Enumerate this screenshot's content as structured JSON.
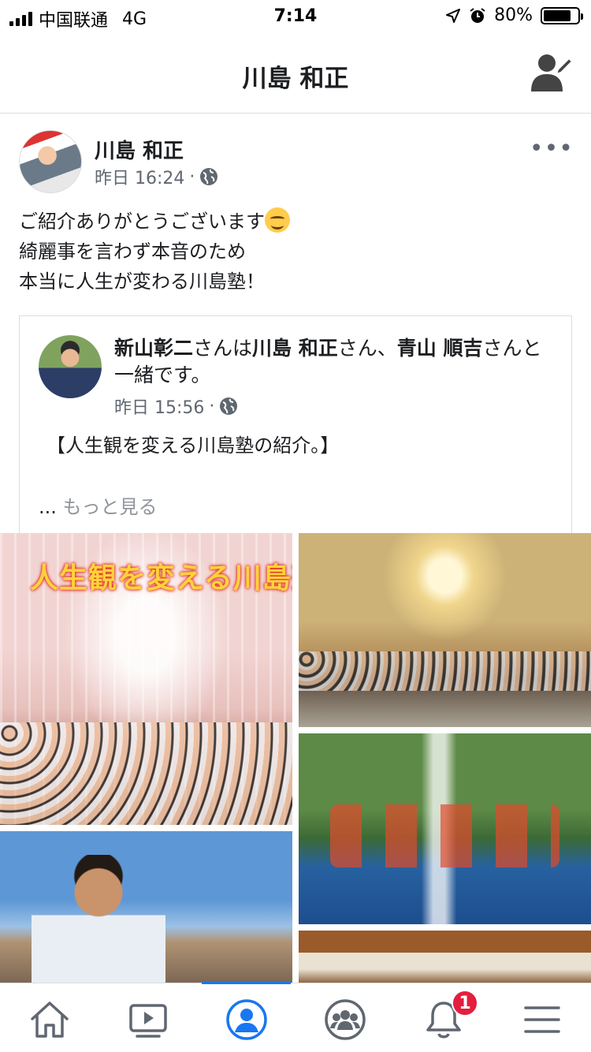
{
  "status_bar": {
    "carrier": "中国联通",
    "network": "4G",
    "time": "7:14",
    "battery": "80%",
    "battery_level": 0.8
  },
  "header": {
    "title": "川島 和正",
    "edit_icon": "profile-edit-icon"
  },
  "post": {
    "author": "川島 和正",
    "time": "昨日 16:24",
    "separator": "·",
    "privacy_icon": "globe-icon",
    "lines": [
      "ご紹介ありがとうございます",
      "綺麗事を言わず本音のため",
      "本当に人生が変わる川島塾！"
    ],
    "shared": {
      "author": "新山彰二",
      "with_text": "さんは",
      "tagged_1": "川島 和正",
      "sep_1": "さん、",
      "tagged_2": "青山 順吉",
      "suffix": "さんと一緒です。",
      "time": "昨日 15:56",
      "body": "【人生観を変える川島塾の紹介。】",
      "see_more_dots": "...",
      "see_more": "もっと見る"
    },
    "photo_banner": "人生観を変える川島塾"
  },
  "tabbar": {
    "items": [
      "home-icon",
      "watch-icon",
      "profile-icon",
      "groups-icon",
      "notifications-icon",
      "menu-icon"
    ],
    "active_index": 2,
    "notification_count": "1",
    "accent_color": "#1877f2"
  }
}
